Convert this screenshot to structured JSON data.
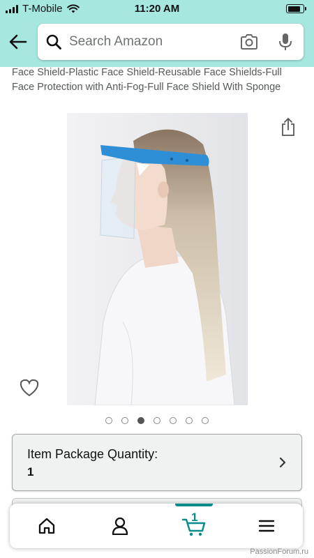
{
  "status_bar": {
    "carrier": "T-Mobile",
    "time": "11:20 AM",
    "battery_level": 0.85
  },
  "header": {
    "back_icon": "arrow-left-icon",
    "search_placeholder": "Search Amazon",
    "camera_icon": "camera-icon",
    "mic_icon": "microphone-icon",
    "background_color": "#a6e7e0"
  },
  "product": {
    "title": "Face Shield-Plastic Face Shield-Reusable Face Shields-Full Face Protection with Anti-Fog-Full Face Shield With Sponge",
    "image_count": 7,
    "active_image_index": 2
  },
  "quantity": {
    "label": "Item Package Quantity:",
    "value": "1"
  },
  "bottom_nav": {
    "items": [
      "home-icon",
      "account-icon",
      "cart-icon",
      "menu-icon"
    ],
    "cart_count": "1",
    "active_index": 2,
    "accent_color": "#078c8c"
  },
  "watermark": "PassionForum.ru"
}
